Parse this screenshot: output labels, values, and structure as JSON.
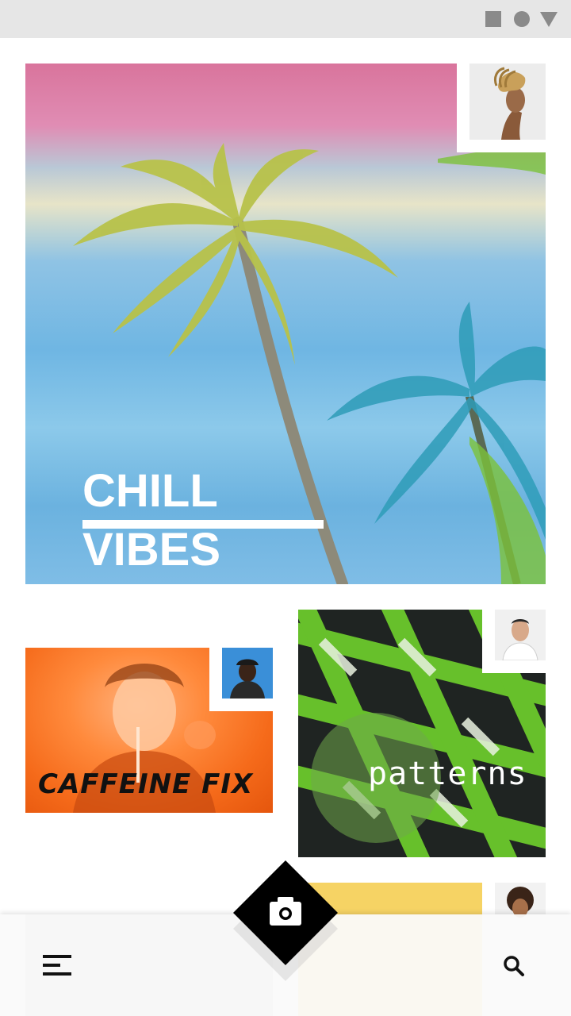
{
  "status_bar": {
    "icons": [
      "square-icon",
      "circle-icon",
      "triangle-icon"
    ]
  },
  "feed": {
    "cards": [
      {
        "title": "CHILL VIBES",
        "avatar": "avatar-woman-dreadlocks"
      },
      {
        "title": "CAFFEINE FIX",
        "avatar": "avatar-man-cap"
      },
      {
        "title": "patterns",
        "avatar": "avatar-man-shirt"
      },
      {
        "title": "",
        "avatar": "avatar-woman-curly"
      }
    ]
  },
  "bottom_nav": {
    "menu_icon": "menu-icon",
    "camera_icon": "camera-icon",
    "search_icon": "search-icon"
  },
  "colors": {
    "caffeine_orange": "#f56a1a",
    "patterns_green": "#6fd12c",
    "yellow": "#f6d364",
    "fab_black": "#000000"
  }
}
